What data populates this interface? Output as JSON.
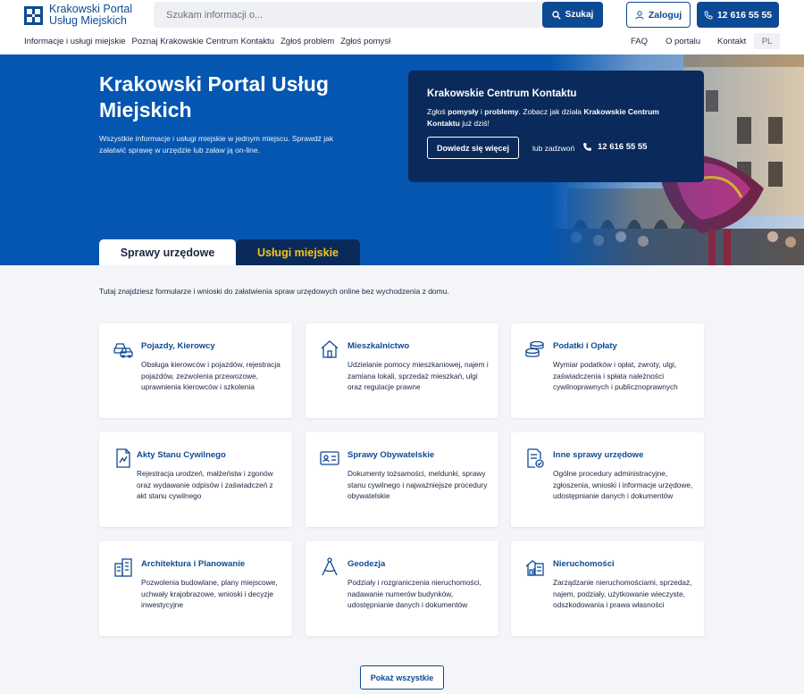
{
  "header": {
    "logo_line1": "Krakowski Portal",
    "logo_line2": "Usług Miejskich",
    "search_placeholder": "Szukam informacji o...",
    "search_label": "Szukaj",
    "login_label": "Zaloguj",
    "phone_label": "12 616 55 55"
  },
  "nav": {
    "left": [
      "Informacje i usługi miejskie",
      "Poznaj Krakowskie Centrum Kontaktu",
      "Zgłoś problem",
      "Zgłoś pomysł"
    ],
    "right": [
      "FAQ",
      "O portalu",
      "Kontakt"
    ],
    "lang": "PL"
  },
  "hero": {
    "title": "Krakowski Portal Usług Miejskich",
    "subtitle": "Wszystkie informacje i usługi miejskie w jednym miejscu. Sprawdź jak załatwić sprawę w urzędzie lub zaław ją on-line."
  },
  "kck": {
    "title": "Krakowskie Centrum Kontaktu",
    "text_1": "Zgłoś ",
    "text_b1": "pomysły",
    "text_2": " i ",
    "text_b2": "problemy",
    "text_3": ". Zobacz jak działa ",
    "text_b3": "Krakowskie Centrum Kontaktu",
    "text_4": " już dziś!",
    "button": "Dowiedz się więcej",
    "or": "lub zadzwoń",
    "phone": "12 616 55 55"
  },
  "tabs": [
    "Sprawy urzędowe",
    "Usługi miejskie"
  ],
  "intro": "Tutaj znajdziesz formularze i wnioski do załatwienia spraw urzędowych online bez wychodzenia z domu.",
  "cards": [
    {
      "title": "Pojazdy, Kierowcy",
      "desc": "Obsługa kierowców i pojazdów, rejestracja pojazdów, zezwolenia przewozowe, uprawnienia kierowców i szkolenia",
      "icon": "cars-icon"
    },
    {
      "title": "Mieszkalnictwo",
      "desc": "Udzielanie pomocy mieszkaniowej, najem i zamiana lokali, sprzedaż mieszkań, ulgi oraz regulacje prawne",
      "icon": "house-icon"
    },
    {
      "title": "Podatki i Opłaty",
      "desc": "Wymiar podatków i opłat, zwroty, ulgi, zaświadczenia i spłata należności cywilnoprawnych i publicznoprawnych",
      "icon": "coins-icon"
    },
    {
      "title": "Akty Stanu Cywilnego",
      "desc": "Rejestracja urodzeń, małżeństw i zgonów oraz wydawanie odpisów i zaświadczeń z akt stanu cywilnego",
      "icon": "document-chart-icon"
    },
    {
      "title": "Sprawy Obywatelskie",
      "desc": "Dokumenty tożsamości, meldunki, sprawy stanu cywilnego i najważniejsze procedury obywatelskie",
      "icon": "id-card-icon"
    },
    {
      "title": "Inne sprawy urzędowe",
      "desc": "Ogólne procedury administracyjne, zgłoszenia, wnioski i informacje urzędowe, udostępnianie danych i dokumentów",
      "icon": "document-check-icon"
    },
    {
      "title": "Architektura i Planowanie",
      "desc": "Pozwolenia budowlane, plany miejscowe, uchwały krajobrazowe, wnioski i decyzje inwestycyjne",
      "icon": "buildings-icon"
    },
    {
      "title": "Geodezja",
      "desc": "Podziały i rozgraniczenia nieruchomości, nadawanie numerów budynków, udostępnianie danych i dokumentów",
      "icon": "compass-icon"
    },
    {
      "title": "Nieruchomości",
      "desc": "Zarządzanie nieruchomościami, sprzedaż, najem, podziały, użytkowanie wieczyste, odszkodowania i prawa własności",
      "icon": "real-estate-icon"
    }
  ],
  "show_all": "Pokaż wszystkie",
  "colors": {
    "brand": "#0d4a94",
    "hero": "#0556b1",
    "dark": "#0a2a5c",
    "accent": "#f3c317"
  }
}
